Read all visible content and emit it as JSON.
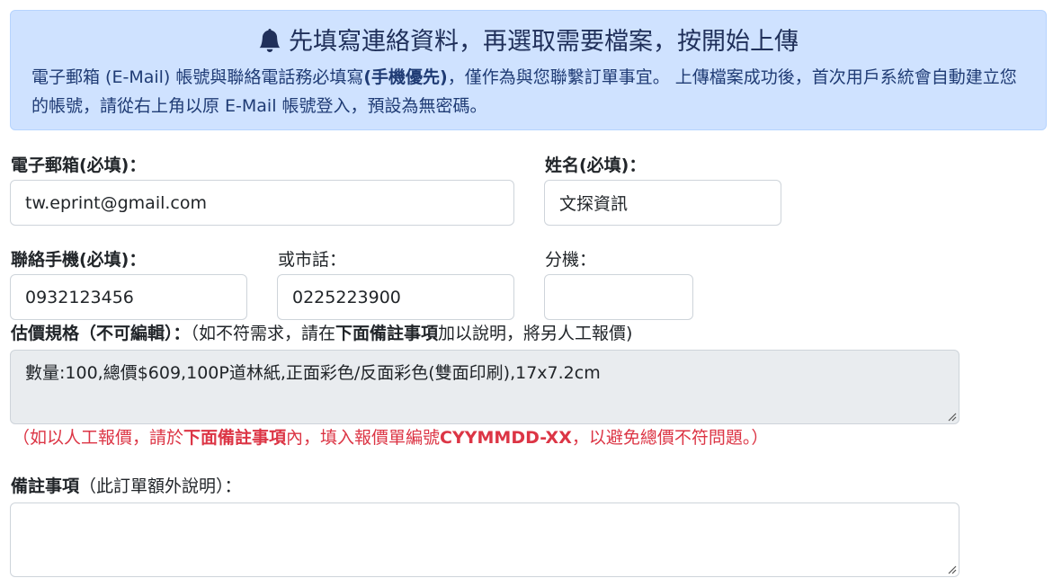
{
  "alert": {
    "title": "先填寫連絡資料，再選取需要檔案，按開始上傳",
    "body_1": "電子郵箱 (E-Mail) 帳號與聯絡電話務必填寫",
    "body_bold": "(手機優先)",
    "body_2": "，僅作為與您聯繫訂單事宜。 上傳檔案成功後，首次用戶系統會自動建立您的帳號，請從右上角以原 E-Mail 帳號登入，預設為無密碼。"
  },
  "fields": {
    "email_label": "電子郵箱(必填)：",
    "email_value": "tw.eprint@gmail.com",
    "name_label": "姓名(必填)：",
    "name_value": "文探資訊",
    "mobile_label": "聯絡手機(必填)：",
    "mobile_value": "0932123456",
    "phone_label": "或市話：",
    "phone_value": "0225223900",
    "ext_label": "分機：",
    "ext_value": ""
  },
  "spec": {
    "label_bold": "估價規格（不可編輯）：",
    "label_normal_1": "（如不符需求，請在",
    "label_bold_2": "下面備註事項",
    "label_normal_2": "加以說明，將另人工報價)",
    "value": "數量:100,總價$609,100P道林紙,正面彩色/反面彩色(雙面印刷),17x7.2cm"
  },
  "note": {
    "part_1": "（如以人工報價，請於",
    "bold_1": "下面備註事項",
    "part_2": "內，填入報價單編號",
    "bold_2": "CYYMMDD-XX",
    "part_3": "，以避免總價不符問題。）"
  },
  "remarks": {
    "label_bold": "備註事項",
    "label_normal": "（此訂單額外說明）：",
    "value": ""
  },
  "colors": {
    "alert_bg": "#cfe2ff",
    "note_red": "#dc3545",
    "readonly_bg": "#e9ecef"
  }
}
